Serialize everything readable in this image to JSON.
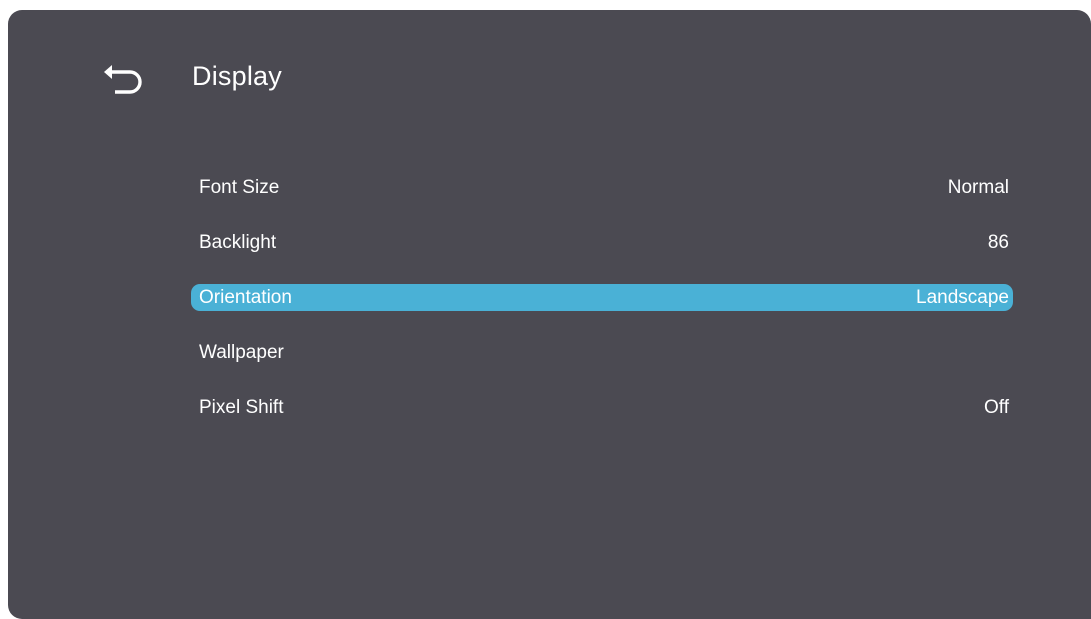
{
  "header": {
    "back_icon": "back-arrow-icon",
    "title": "Display"
  },
  "colors": {
    "panel_background": "#4b4a52",
    "selection_highlight": "#4ab1d6",
    "text": "#ffffff"
  },
  "menu": {
    "items": [
      {
        "label": "Font Size",
        "value": "Normal",
        "selected": false
      },
      {
        "label": "Backlight",
        "value": "86",
        "selected": false
      },
      {
        "label": "Orientation",
        "value": "Landscape",
        "selected": true
      },
      {
        "label": "Wallpaper",
        "value": "",
        "selected": false
      },
      {
        "label": "Pixel Shift",
        "value": "Off",
        "selected": false
      }
    ]
  }
}
